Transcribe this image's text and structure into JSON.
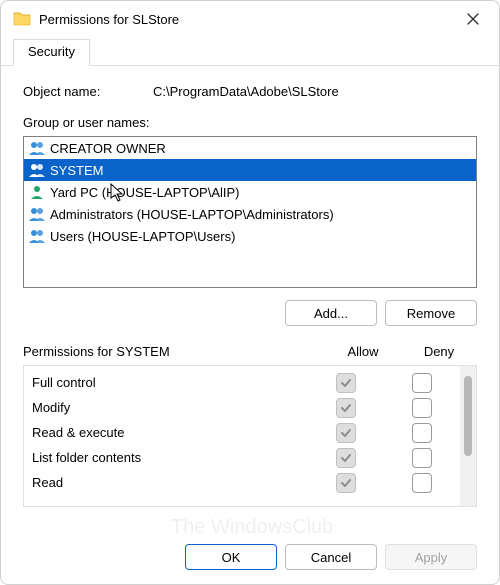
{
  "title": "Permissions for SLStore",
  "tab": "Security",
  "objectNameLabel": "Object name:",
  "objectName": "C:\\ProgramData\\Adobe\\SLStore",
  "groupLabel": "Group or user names:",
  "principals": [
    {
      "icon": "group",
      "label": "CREATOR OWNER",
      "selected": false
    },
    {
      "icon": "group",
      "label": "SYSTEM",
      "selected": true
    },
    {
      "icon": "user",
      "label": "Yard PC (HOUSE-LAPTOP\\AlIP)",
      "selected": false
    },
    {
      "icon": "group",
      "label": "Administrators (HOUSE-LAPTOP\\Administrators)",
      "selected": false
    },
    {
      "icon": "group",
      "label": "Users (HOUSE-LAPTOP\\Users)",
      "selected": false
    }
  ],
  "addLabel": "Add...",
  "removeLabel": "Remove",
  "permHeader": "Permissions for SYSTEM",
  "allowLabel": "Allow",
  "denyLabel": "Deny",
  "permissions": [
    {
      "name": "Full control",
      "allow": true,
      "allowDisabled": true,
      "deny": false
    },
    {
      "name": "Modify",
      "allow": true,
      "allowDisabled": true,
      "deny": false
    },
    {
      "name": "Read & execute",
      "allow": true,
      "allowDisabled": true,
      "deny": false
    },
    {
      "name": "List folder contents",
      "allow": true,
      "allowDisabled": true,
      "deny": false
    },
    {
      "name": "Read",
      "allow": true,
      "allowDisabled": true,
      "deny": false
    }
  ],
  "okLabel": "OK",
  "cancelLabel": "Cancel",
  "applyLabel": "Apply",
  "watermark": "The\nWindowsClub"
}
